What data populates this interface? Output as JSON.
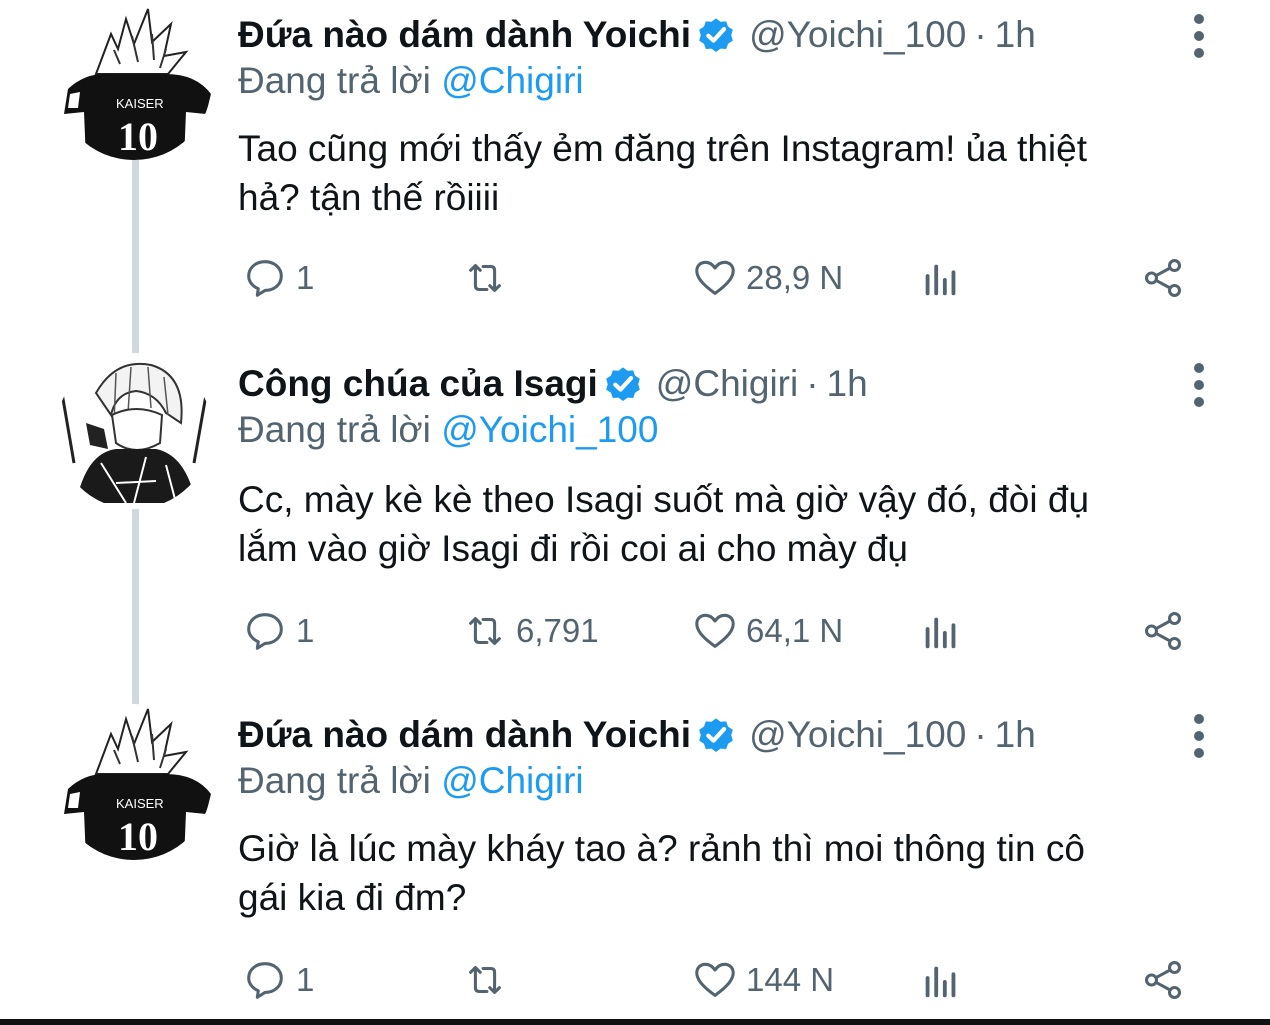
{
  "colors": {
    "accent": "#1d9bf0",
    "muted": "#536471",
    "text": "#0f1419",
    "thread_line": "#cfd9de"
  },
  "tweets": [
    {
      "display_name": "Đứa nào dám dành Yoichi",
      "handle": "@Yoichi_100",
      "separator": "·",
      "time": "1h",
      "replying_prefix": "Đang trả lời",
      "replying_to": "@Chigiri",
      "text_line1": "Tao cũng mới thấy ẻm đăng trên Instagram! ủa thiệt",
      "text_line2": "hả? tận thế rồiiii",
      "replies": "1",
      "retweets": "",
      "likes": "28,9 N",
      "avatar_caption": "KAISER",
      "avatar_number": "10"
    },
    {
      "display_name": "Công chúa của Isagi",
      "handle": "@Chigiri",
      "separator": "·",
      "time": "1h",
      "replying_prefix": "Đang trả lời",
      "replying_to": "@Yoichi_100",
      "text_line1": "Cc, mày kè kè theo Isagi suốt mà giờ vậy đó, đòi đụ",
      "text_line2": "lắm vào giờ Isagi đi rồi coi ai cho mày đụ",
      "replies": "1",
      "retweets": "6,791",
      "likes": "64,1 N"
    },
    {
      "display_name": "Đứa nào dám dành Yoichi",
      "handle": "@Yoichi_100",
      "separator": "·",
      "time": "1h",
      "replying_prefix": "Đang trả lời",
      "replying_to": "@Chigiri",
      "text_line1": "Giờ là lúc mày kháy tao à? rảnh thì moi thông tin cô",
      "text_line2": "gái kia đi đm?",
      "replies": "1",
      "retweets": "",
      "likes": "144 N",
      "avatar_caption": "KAISER",
      "avatar_number": "10"
    }
  ],
  "icons": {
    "reply": "reply-icon",
    "retweet": "retweet-icon",
    "like": "heart-icon",
    "views": "views-icon",
    "share": "share-icon",
    "verified": "verified-badge-icon",
    "more": "more-icon"
  }
}
